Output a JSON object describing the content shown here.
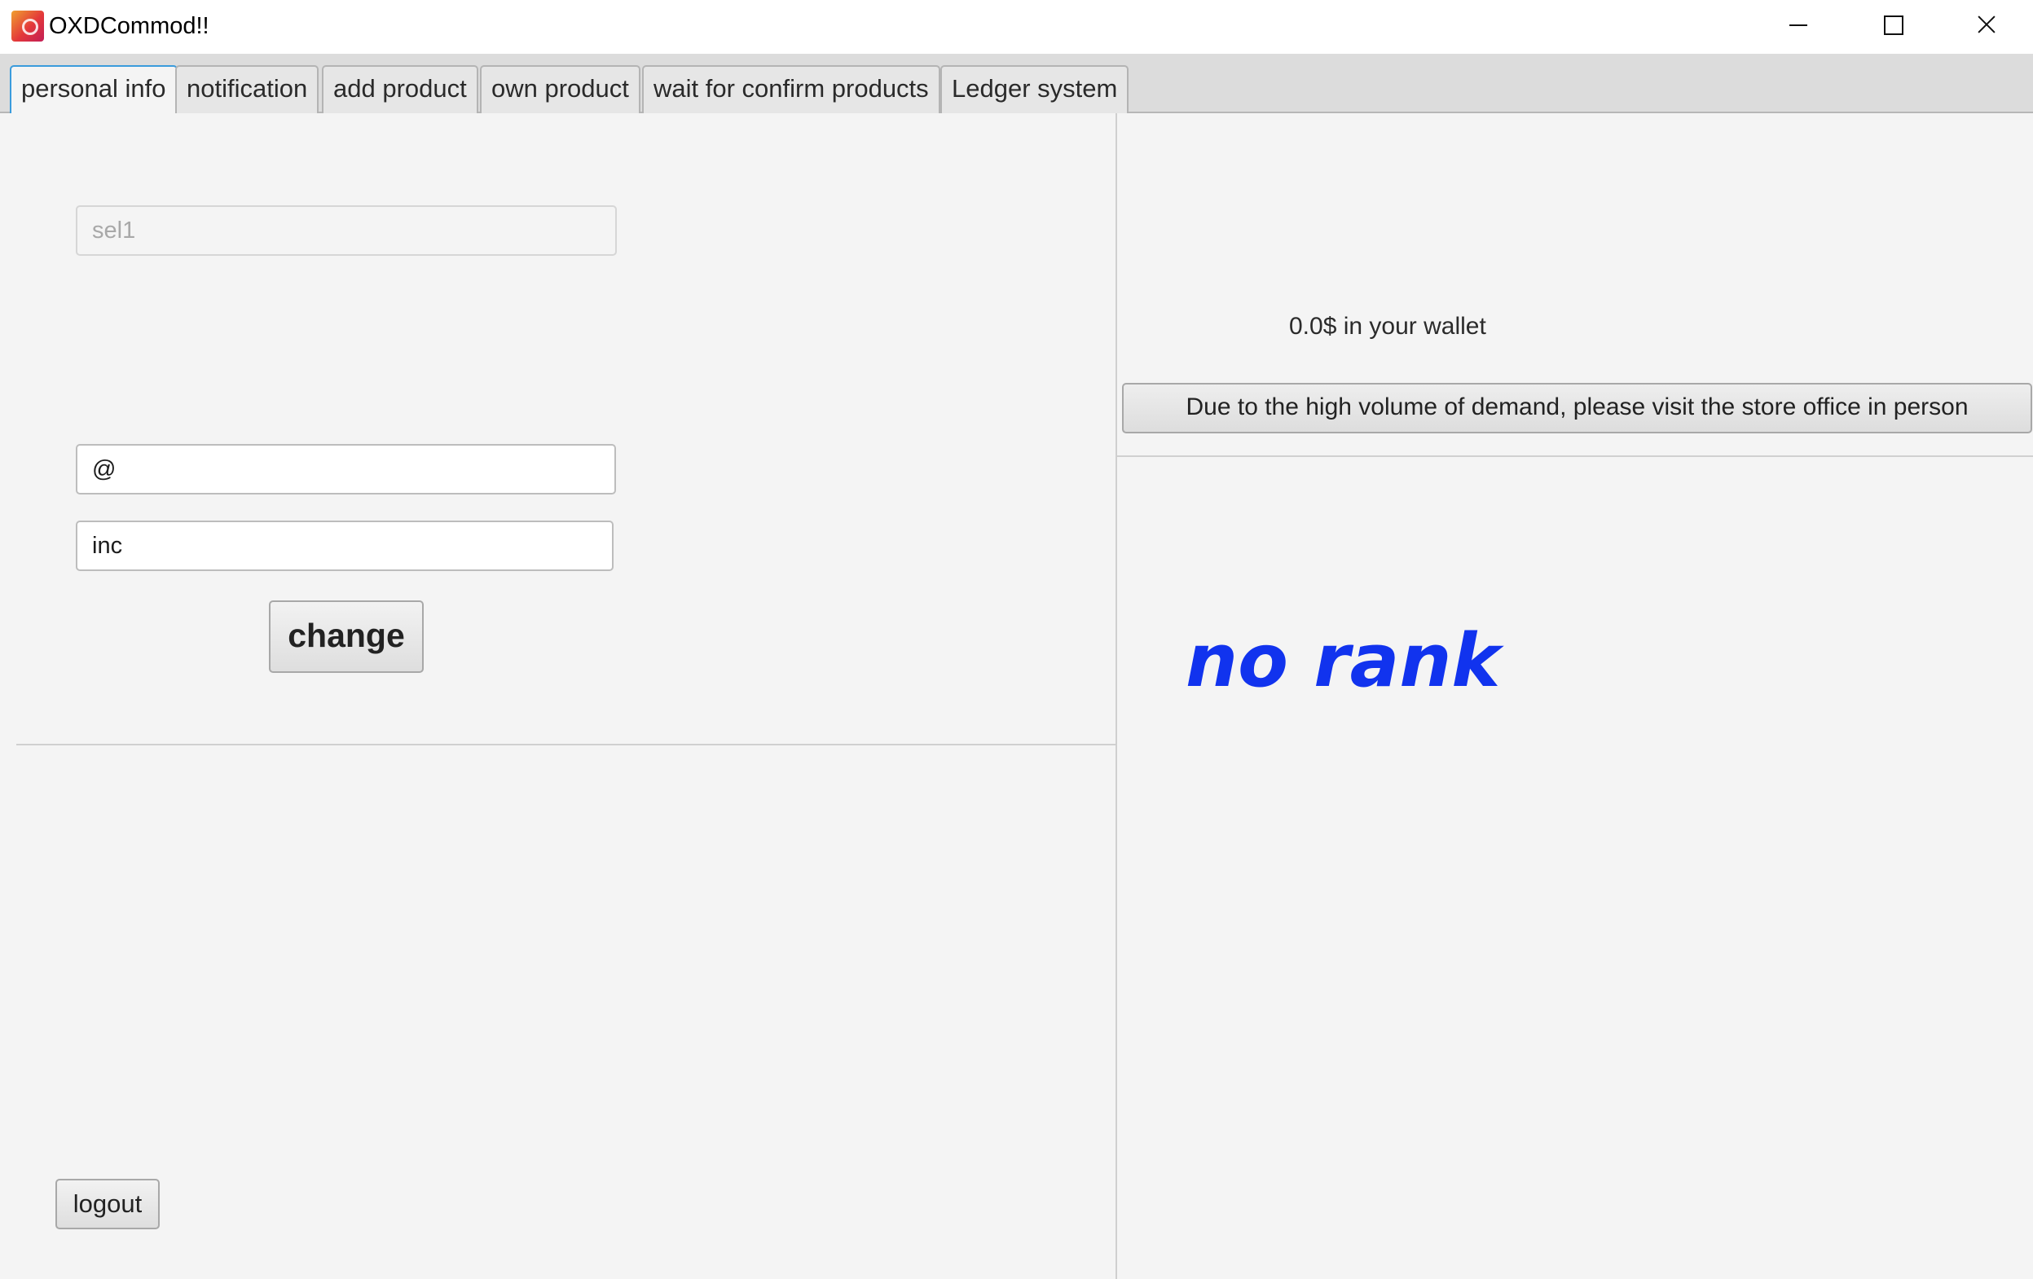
{
  "window": {
    "title": "OXDCommod!!"
  },
  "tabs": [
    {
      "label": "personal info",
      "active": true
    },
    {
      "label": "notification",
      "active": false
    },
    {
      "label": "add product",
      "active": false
    },
    {
      "label": "own product",
      "active": false
    },
    {
      "label": "wait for confirm products",
      "active": false
    },
    {
      "label": "Ledger system",
      "active": false
    }
  ],
  "personal_info": {
    "username_value": "sel1",
    "email_value": "@",
    "company_value": "inc",
    "change_label": "change",
    "logout_label": "logout"
  },
  "wallet": {
    "balance_text": "0.0$ in your wallet",
    "notice_label": "Due to the high volume of demand, please visit the store office in person"
  },
  "rank": {
    "text": "no rank",
    "color": "#1133ee"
  },
  "colors": {
    "active_tab_border": "#3a9bdc",
    "background": "#f4f4f4"
  }
}
